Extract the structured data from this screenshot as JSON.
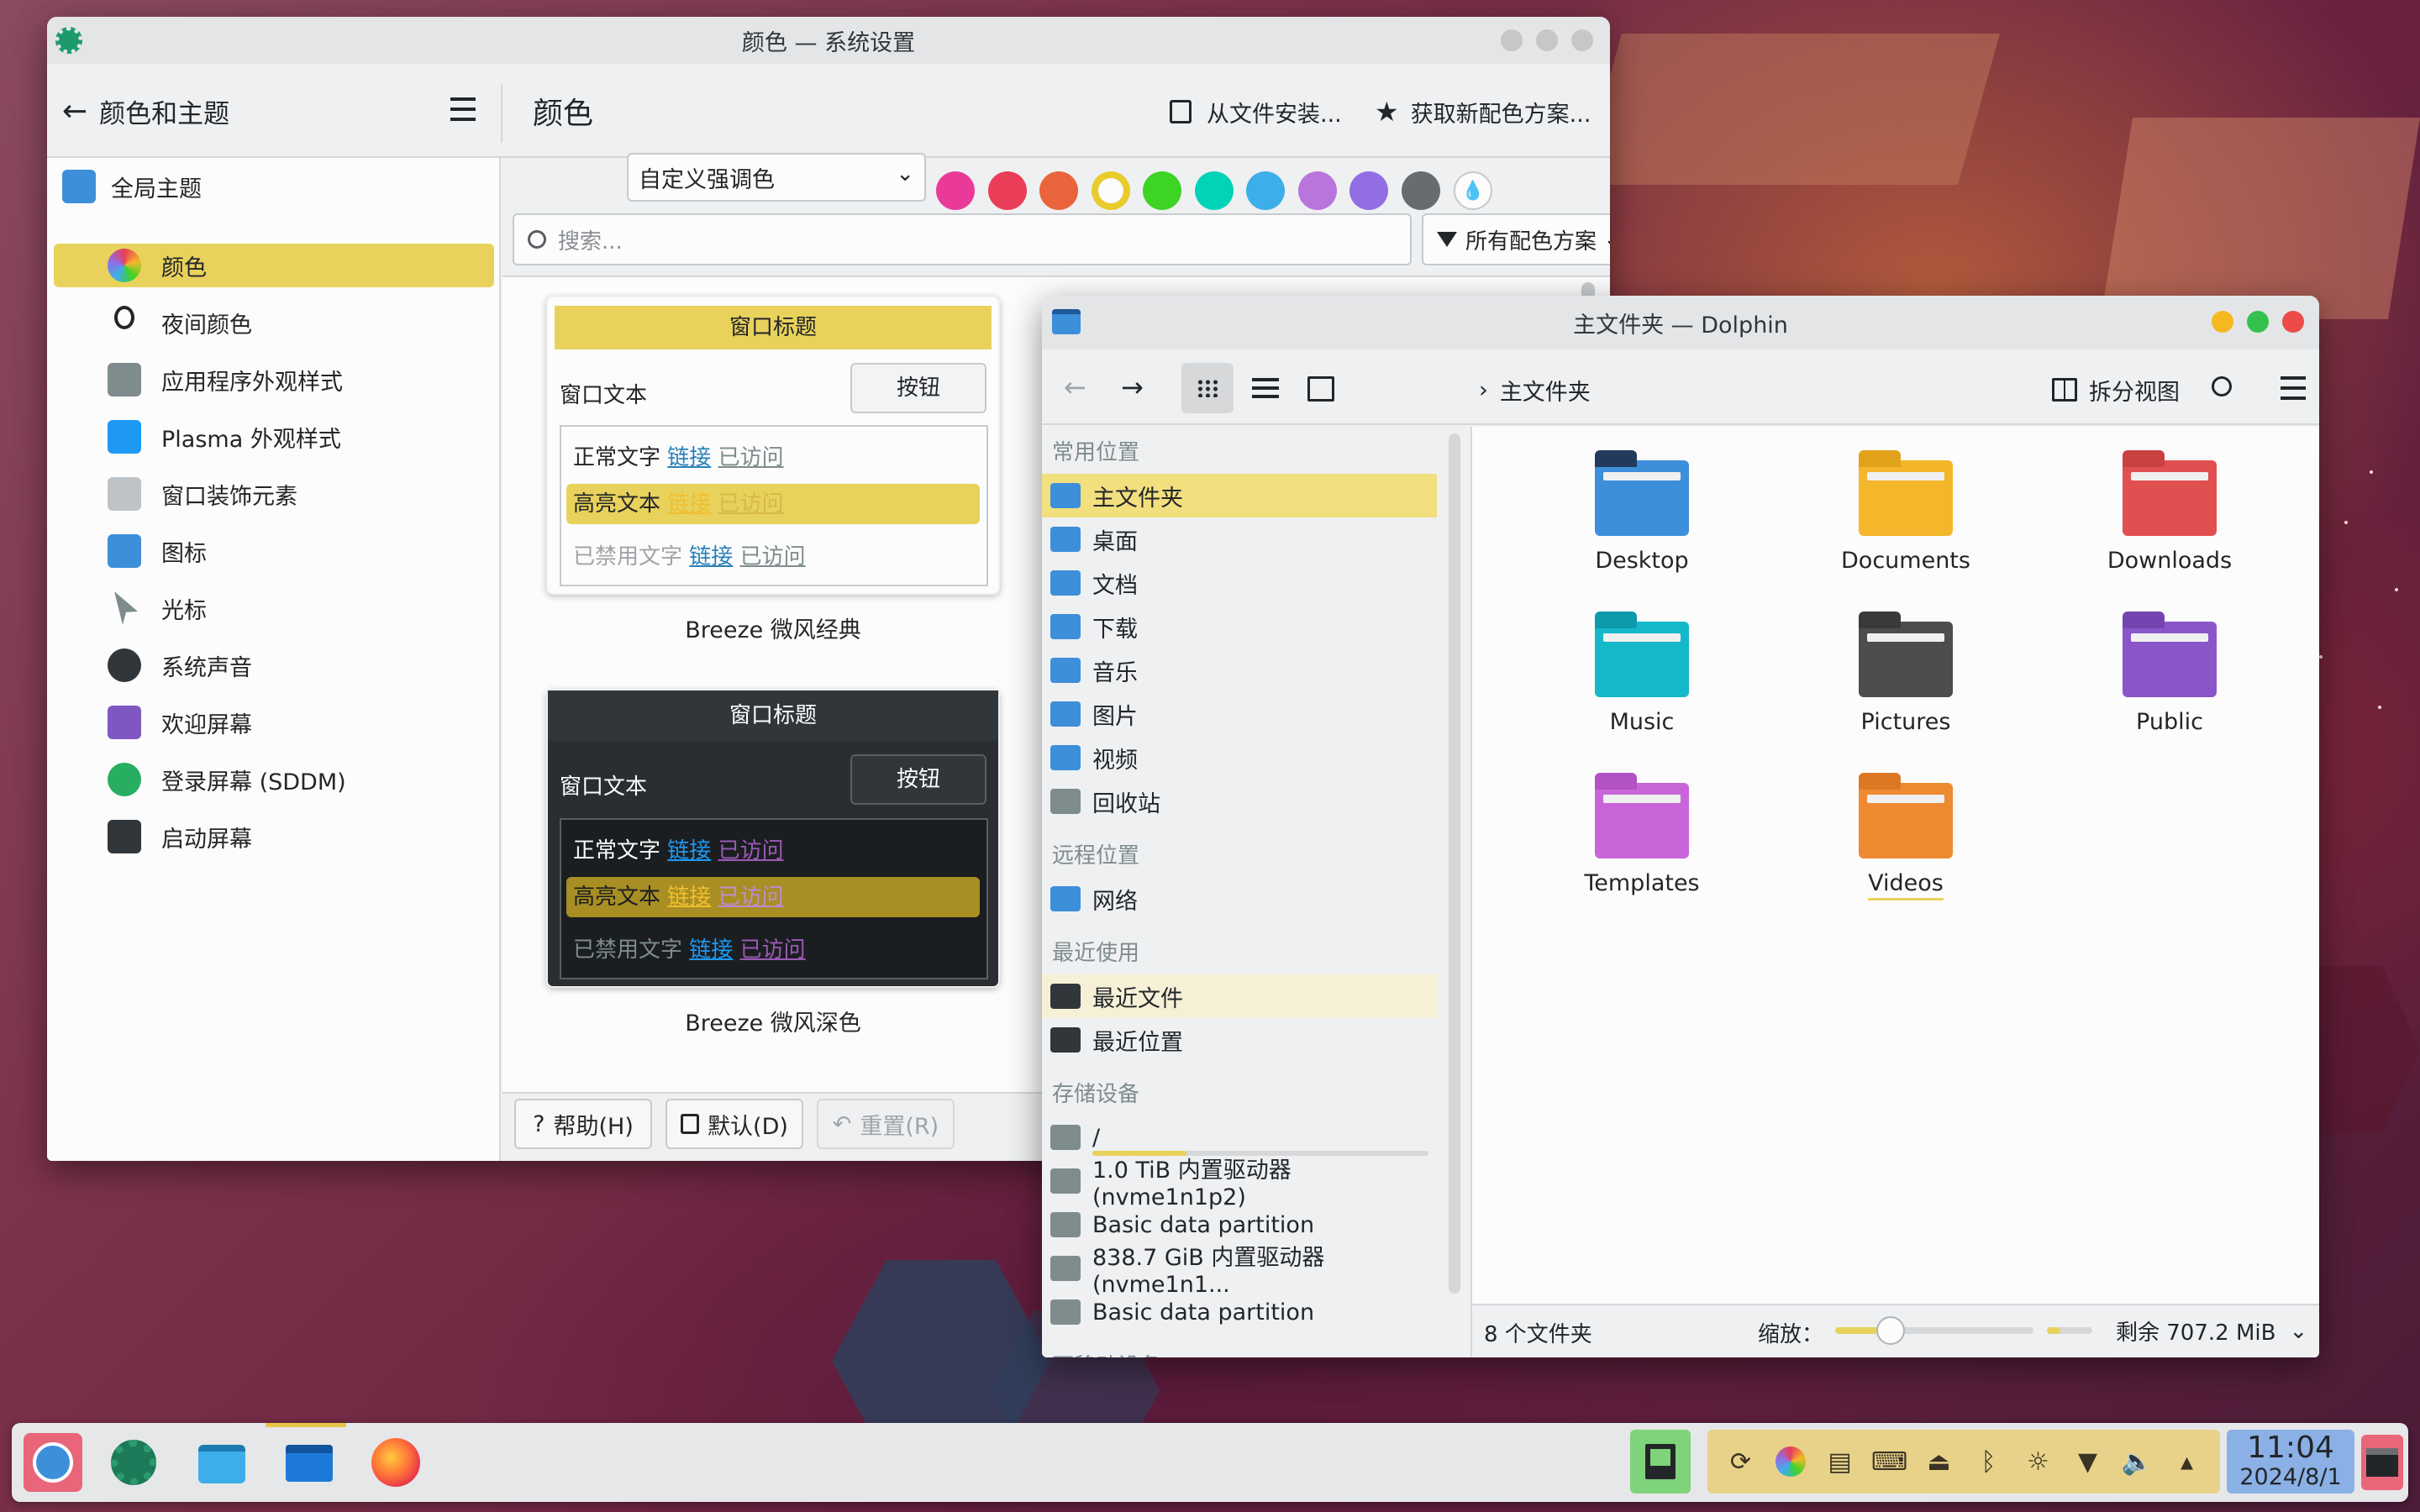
{
  "settings": {
    "window_title": "颜色 — 系统设置",
    "back_label": "颜色和主题",
    "page_title": "颜色",
    "install_from_file": "从文件安装...",
    "get_new": "获取新配色方案...",
    "accent_select": "自定义强调色",
    "search_placeholder": "搜索...",
    "filter_label": "所有配色方案",
    "accent_colors": [
      "#e93a9a",
      "#e93d58",
      "#e9643a",
      "#e8cb2d",
      "#3dd425",
      "#00d3b8",
      "#3daee9",
      "#b875dc",
      "#926ee4",
      "#686b6f"
    ],
    "sidebar": [
      {
        "label": "全局主题",
        "icon": "global-theme-icon",
        "selected": false,
        "color": "#3d8fd9"
      },
      {
        "label": "颜色",
        "icon": "colors-icon",
        "selected": true,
        "color": "#e93d58"
      },
      {
        "label": "夜间颜色",
        "icon": "night-color-icon",
        "selected": false,
        "color": "#232629"
      },
      {
        "label": "应用程序外观样式",
        "icon": "app-style-icon",
        "selected": false,
        "color": "#7f8c8d"
      },
      {
        "label": "Plasma 外观样式",
        "icon": "plasma-style-icon",
        "selected": false,
        "color": "#1d99f3"
      },
      {
        "label": "窗口装饰元素",
        "icon": "window-decoration-icon",
        "selected": false,
        "color": "#bdc3c7"
      },
      {
        "label": "图标",
        "icon": "icons-icon",
        "selected": false,
        "color": "#3d8fd9"
      },
      {
        "label": "光标",
        "icon": "cursor-icon",
        "selected": false,
        "color": "#7f8c8d"
      },
      {
        "label": "系统声音",
        "icon": "sound-icon",
        "selected": false,
        "color": "#31363b"
      },
      {
        "label": "欢迎屏幕",
        "icon": "splash-icon",
        "selected": false,
        "color": "#7e57c2"
      },
      {
        "label": "登录屏幕 (SDDM)",
        "icon": "login-icon",
        "selected": false,
        "color": "#27ae60"
      },
      {
        "label": "启动屏幕",
        "icon": "boot-icon",
        "selected": false,
        "color": "#31363b"
      }
    ],
    "schemes": [
      {
        "name": "Breeze 微风经典",
        "window_title": "窗口标题",
        "window_text": "窗口文本",
        "button": "按钮",
        "normal": "正常文字",
        "link": "链接",
        "visited": "已访问",
        "highlight": "高亮文本",
        "disabled": "已禁用文字"
      },
      {
        "name": "Breeze 微风深色",
        "window_title": "窗口标题",
        "window_text": "窗口文本",
        "button": "按钮",
        "normal": "正常文字",
        "link": "链接",
        "visited": "已访问",
        "highlight": "高亮文本",
        "disabled": "已禁用文字"
      }
    ],
    "footer": {
      "help": "帮助(H)",
      "defaults": "默认(D)",
      "reset": "重置(R)"
    }
  },
  "dolphin": {
    "window_title": "主文件夹 — Dolphin",
    "breadcrumb": "主文件夹",
    "split_view": "拆分视图",
    "sections": {
      "places": "常用位置",
      "remote": "远程位置",
      "recent": "最近使用",
      "devices": "存储设备",
      "removable": "可移动设备"
    },
    "places": [
      "主文件夹",
      "桌面",
      "文档",
      "下载",
      "音乐",
      "图片",
      "视频",
      "回收站"
    ],
    "remote": [
      "网络"
    ],
    "recent": [
      "最近文件",
      "最近位置"
    ],
    "devices": [
      "/",
      "1.0 TiB 内置驱动器 (nvme1n1p2)",
      "Basic data partition",
      "838.7 GiB 内置驱动器 (nvme1n1...",
      "Basic data partition"
    ],
    "root_usage_fraction": 0.28,
    "folders": [
      {
        "name": "Desktop",
        "color": "#3d8fd9",
        "tab": "#233a5c"
      },
      {
        "name": "Documents",
        "color": "#f4b62a",
        "tab": "#e2a21c"
      },
      {
        "name": "Downloads",
        "color": "#e05050",
        "tab": "#c94242"
      },
      {
        "name": "Music",
        "color": "#15b8c9",
        "tab": "#0d9aab"
      },
      {
        "name": "Pictures",
        "color": "#4d4d4d",
        "tab": "#3a3a3a"
      },
      {
        "name": "Public",
        "color": "#8a55c8",
        "tab": "#7444b0"
      },
      {
        "name": "Templates",
        "color": "#c865d8",
        "tab": "#b352c4"
      },
      {
        "name": "Videos",
        "color": "#ee8a32",
        "tab": "#dd7822"
      }
    ],
    "status_count": "8 个文件夹",
    "zoom_label": "缩放：",
    "zoom_fraction": 0.28,
    "free_space": "剩余 707.2 MiB"
  },
  "taskbar": {
    "clock_time": "11:04",
    "clock_date": "2024/8/1",
    "apps": [
      "launcher-icon",
      "system-settings-icon",
      "discover-icon",
      "dolphin-icon",
      "firefox-icon"
    ]
  }
}
